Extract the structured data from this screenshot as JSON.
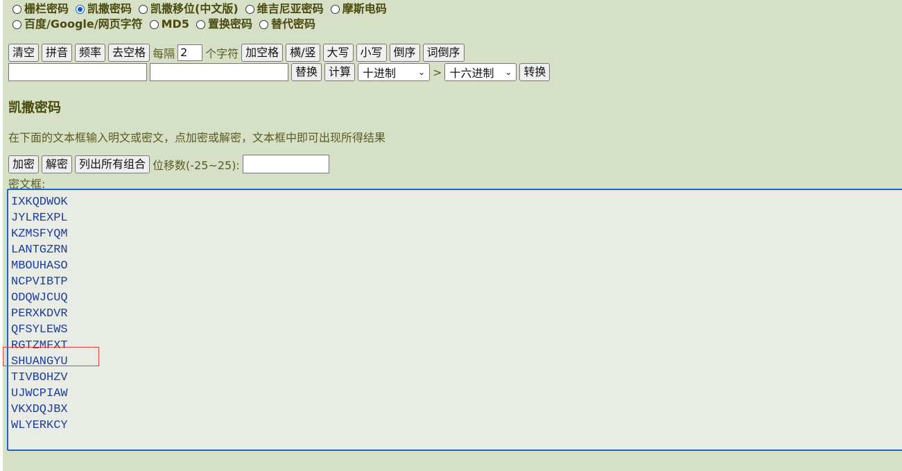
{
  "cipher_options": [
    {
      "label": "栅栏密码",
      "checked": false
    },
    {
      "label": "凯撒密码",
      "checked": true
    },
    {
      "label": "凯撒移位(中文版)",
      "checked": false
    },
    {
      "label": "维吉尼亚密码",
      "checked": false
    },
    {
      "label": "摩斯电码",
      "checked": false
    },
    {
      "label": "百度/Google/网页字符",
      "checked": false
    },
    {
      "label": "MD5",
      "checked": false
    },
    {
      "label": "置换密码",
      "checked": false
    },
    {
      "label": "替代密码",
      "checked": false
    }
  ],
  "toolbar": {
    "clear": "清空",
    "pinyin": "拼音",
    "frequency": "频率",
    "remove_spaces": "去空格",
    "every_prefix": "每隔",
    "every_value": "2",
    "every_suffix": "个字符",
    "add_spaces": "加空格",
    "horizontal_vertical": "横/竖",
    "uppercase": "大写",
    "lowercase": "小写",
    "reverse": "倒序",
    "word_reverse": "词倒序"
  },
  "converter": {
    "replace": "替换",
    "calculate": "计算",
    "from_base": "十进制",
    "arrow": ">",
    "to_base": "十六进制",
    "convert": "转换"
  },
  "section": {
    "title": "凯撒密码",
    "instruction": "在下面的文本框输入明文或密文，点加密或解密，文本框中即可出现所得结果"
  },
  "actions": {
    "encrypt": "加密",
    "decrypt": "解密",
    "list_all": "列出所有组合",
    "shift_label": "位移数(-25~25):",
    "shift_value": ""
  },
  "cipher_box": {
    "label": "密文框:",
    "lines": [
      "IXKQDWOK",
      "JYLREXPL",
      "KZMSFYQM",
      "LANTGZRN",
      "MBOUHASO",
      "NCPVIBTP",
      "ODQWJCUQ",
      "PERXKDVR",
      "QFSYLEWS",
      "RGTZMFXT",
      "SHUANGYU",
      "TIVBOHZV",
      "UJWCPIAW",
      "VKXDQJBX",
      "WLYERKCY"
    ],
    "highlighted_line": "SHUANGYU"
  },
  "colors": {
    "background": "#d6e0c6",
    "heading": "#4a4a0e",
    "text_area_text": "#1c3d9b",
    "text_area_border": "#1a63c8",
    "highlight": "#e0413a"
  }
}
